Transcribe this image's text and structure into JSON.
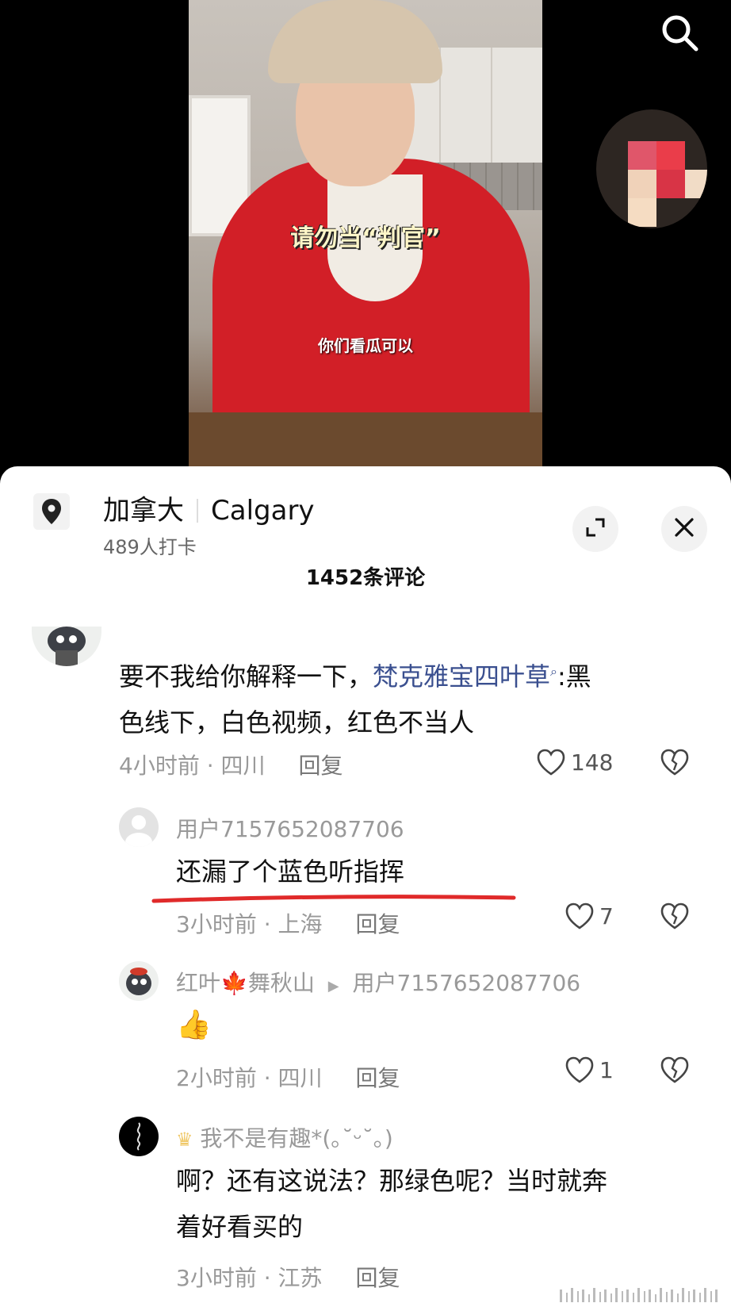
{
  "video": {
    "caption_main": "请勿当“判官”",
    "caption_sub": "你们看瓜可以",
    "search_icon": "search-icon"
  },
  "location": {
    "country": "加拿大",
    "city": "Calgary",
    "checkins": "489人打卡",
    "pin_icon": "location-pin-icon",
    "expand_icon": "expand-icon",
    "close_icon": "close-icon"
  },
  "comments_header": "1452条评论",
  "comments": [
    {
      "text_before": "要不我给你解释一下，",
      "link": "梵克雅宝四叶草",
      "text_after": ":黑色线下，白色视频，红色不当人",
      "line1": "色线下，白色视频，红色不当人",
      "time_loc": "4小时前 · 四川",
      "reply": "回复",
      "likes": "148"
    },
    {
      "name": "用户7157652087706",
      "text": "还漏了个蓝色听指挥",
      "time_loc": "3小时前 · 上海",
      "reply": "回复",
      "likes": "7"
    },
    {
      "name": "红叶🍁舞秋山",
      "reply_to": "用户7157652087706",
      "text": "👍",
      "time_loc": "2小时前 · 四川",
      "reply": "回复",
      "likes": "1"
    },
    {
      "name": "我不是有趣*(｡˘ᵕ˘｡)",
      "text_line1": "啊？还有这说法？那绿色呢？当时就奔",
      "text_line2": "着好看买的",
      "time_loc": "3小时前 · 江苏",
      "reply": "回复"
    }
  ],
  "colors": {
    "link": "#3a4f8f",
    "underline": "#e02a2a",
    "meta": "#999999"
  }
}
